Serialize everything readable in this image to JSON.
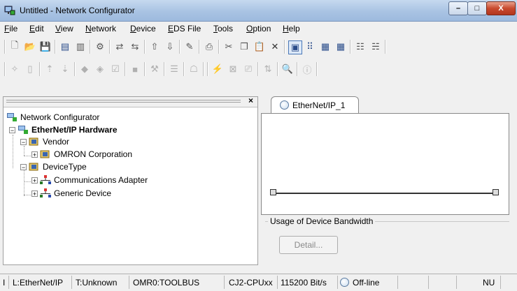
{
  "window": {
    "title": "Untitled - Network Configurator",
    "min_label": "–",
    "max_label": "□",
    "close_label": "X"
  },
  "menu": [
    "File",
    "Edit",
    "View",
    "Network",
    "Device",
    "EDS File",
    "Tools",
    "Option",
    "Help"
  ],
  "menu_underline": [
    "F",
    "E",
    "V",
    "N",
    "D",
    "E",
    "T",
    "O",
    "H"
  ],
  "toolbar1_icons": [
    "new-icon",
    "open-icon",
    "save-icon",
    "network-icon",
    "network2-icon",
    "device-icon",
    "connect-icon",
    "disconnect-icon",
    "upload-icon",
    "download-icon",
    "monitor-icon",
    "print-icon",
    "cut-icon",
    "copy-icon",
    "paste-icon",
    "delete-icon",
    "view-large-icon",
    "view-small-icon",
    "view-list-icon",
    "view-detail-icon",
    "prop-icon",
    "param-icon"
  ],
  "toolbar2_icons": [
    "wizard-icon",
    "doc-icon",
    "up-icon",
    "down-icon",
    "diamond-icon",
    "diamond2-icon",
    "check-icon",
    "stop-icon",
    "config-icon",
    "register-icon",
    "monitor2-icon",
    "online-icon",
    "offline-icon",
    "tool-icon",
    "transfer-icon",
    "find-icon",
    "info-icon"
  ],
  "tree": {
    "root": "Network Configurator",
    "hardware": "EtherNet/IP Hardware",
    "vendor": "Vendor",
    "omron": "OMRON Corporation",
    "devicetype": "DeviceType",
    "comm_adapter": "Communications Adapter",
    "generic": "Generic Device"
  },
  "tab": {
    "label": "EtherNet/IP_1"
  },
  "usage": {
    "label": "Usage of Device Bandwidth",
    "detail_button": "Detail..."
  },
  "status": {
    "s0": "I",
    "s1": "L:EtherNet/IP",
    "s2": "T:Unknown",
    "s3": "OMR0:TOOLBUS",
    "s4": "CJ2-CPUxx",
    "s5": "115200 Bit/s",
    "s6": "Off-line",
    "s7": "NU"
  },
  "colors": {
    "title_bar": "#a9c3e3",
    "close": "#c84a2e",
    "bus": "#333333"
  }
}
